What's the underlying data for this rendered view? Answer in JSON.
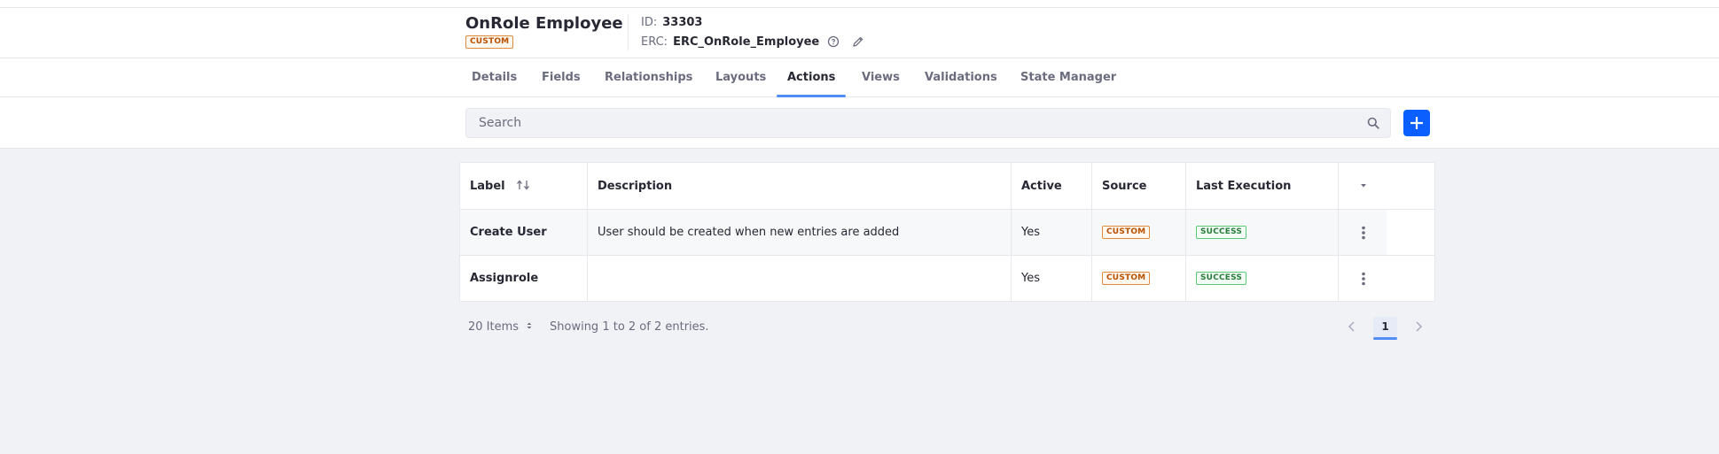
{
  "header": {
    "title": "OnRole Employee",
    "badge": "CUSTOM",
    "id_label": "ID:",
    "id_value": "33303",
    "erc_label": "ERC:",
    "erc_value": "ERC_OnRole_Employee"
  },
  "tabs": [
    {
      "label": "Details",
      "active": false
    },
    {
      "label": "Fields",
      "active": false
    },
    {
      "label": "Relationships",
      "active": false
    },
    {
      "label": "Layouts",
      "active": false
    },
    {
      "label": "Actions",
      "active": true
    },
    {
      "label": "Views",
      "active": false
    },
    {
      "label": "Validations",
      "active": false
    },
    {
      "label": "State Manager",
      "active": false
    }
  ],
  "search": {
    "placeholder": "Search",
    "value": ""
  },
  "table": {
    "columns": [
      "Label",
      "Description",
      "Active",
      "Source",
      "Last Execution"
    ],
    "rows": [
      {
        "label": "Create User",
        "description": "User should be created when new entries are added",
        "active": "Yes",
        "source": "CUSTOM",
        "last_execution": "SUCCESS"
      },
      {
        "label": "Assignrole",
        "description": "",
        "active": "Yes",
        "source": "CUSTOM",
        "last_execution": "SUCCESS"
      }
    ]
  },
  "pagination": {
    "items_per_page": "20 Items",
    "showing": "Showing 1 to 2 of 2 entries.",
    "current_page": "1"
  },
  "colors": {
    "accent": "#0b5fff",
    "tab_indicator": "#528ef7",
    "custom_badge": "#b95000",
    "success_badge": "#287d3c"
  },
  "icons": {
    "help": "help-circle-icon",
    "edit": "pencil-icon",
    "search": "search-icon",
    "add": "plus-icon",
    "sort": "sort-arrows-icon",
    "menu": "caret-down-icon",
    "row_actions": "kebab-vertical-icon",
    "prev": "chevron-left-icon",
    "next": "chevron-right-icon",
    "items_select": "caret-double-icon"
  }
}
